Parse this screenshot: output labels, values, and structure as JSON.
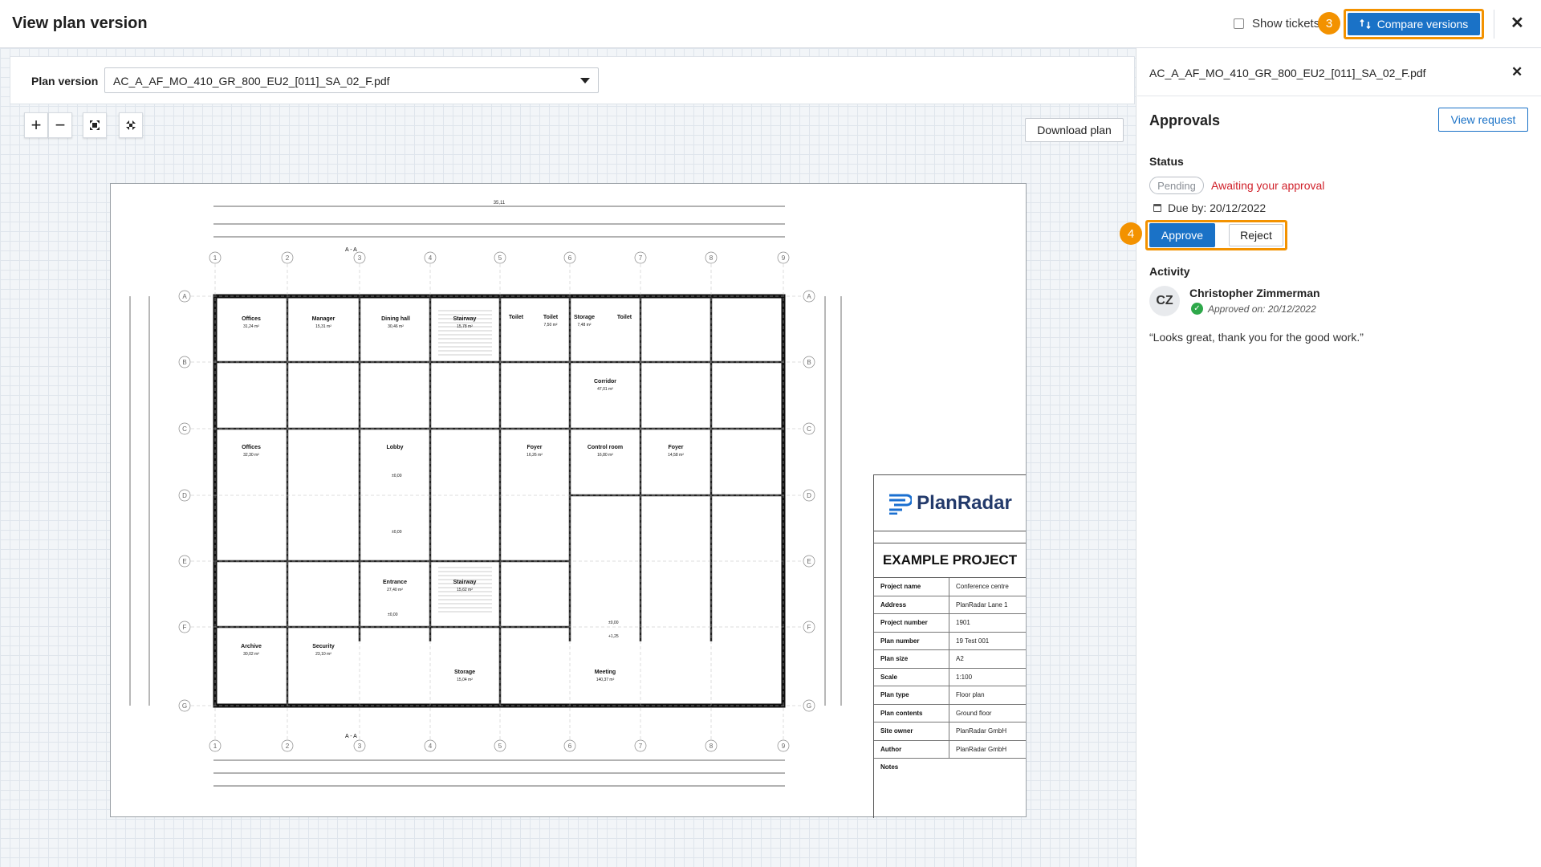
{
  "header": {
    "title": "View plan version",
    "show_tickets_label": "Show tickets",
    "step_3": "3",
    "compare_label": "Compare versions",
    "close_symbol": "✕"
  },
  "toolbar": {
    "plan_version_label": "Plan version",
    "plan_file": "AC_A_AF_MO_410_GR_800_EU2_[011]_SA_02_F.pdf",
    "zoom_in": "+",
    "zoom_out": "−",
    "download_label": "Download plan",
    "icons": [
      "plus-icon",
      "minus-icon",
      "fit-to-screen-icon",
      "collapse-icon",
      "chevron-down-icon"
    ]
  },
  "plan": {
    "logo_text": "PlanRadar",
    "project_title": "EXAMPLE PROJECT",
    "rows": [
      {
        "k": "Project name",
        "v": "Conference centre"
      },
      {
        "k": "Address",
        "v": "PlanRadar Lane 1"
      },
      {
        "k": "Project number",
        "v": "1901"
      },
      {
        "k": "Plan number",
        "v": "19 Test 001"
      },
      {
        "k": "Plan size",
        "v": "A2"
      },
      {
        "k": "Scale",
        "v": "1:100"
      },
      {
        "k": "Plan type",
        "v": "Floor plan"
      },
      {
        "k": "Plan contents",
        "v": "Ground floor"
      },
      {
        "k": "Site owner",
        "v": "PlanRadar GmbH"
      },
      {
        "k": "Author",
        "v": "PlanRadar GmbH"
      }
    ],
    "notes_label": "Notes",
    "rooms": [
      {
        "name": "Offices",
        "area": "31,24 m²"
      },
      {
        "name": "Manager",
        "area": "15,31 m²"
      },
      {
        "name": "Dining hall",
        "area": "30,46 m²"
      },
      {
        "name": "Stairway",
        "area": "15,78 m²"
      },
      {
        "name": "Toilet",
        "area": ""
      },
      {
        "name": "Toilet",
        "area": "7,50 m²"
      },
      {
        "name": "Storage",
        "area": "7,48 m²"
      },
      {
        "name": "Toilet",
        "area": ""
      },
      {
        "name": "Corridor",
        "area": "47,01 m²"
      },
      {
        "name": "Offices",
        "area": "32,30 m²"
      },
      {
        "name": "Lobby",
        "area": ""
      },
      {
        "name": "Foyer",
        "area": "16,26 m²"
      },
      {
        "name": "Control room",
        "area": "16,80 m²"
      },
      {
        "name": "Foyer",
        "area": "14,58 m²"
      },
      {
        "name": "Entrance",
        "area": "27,40 m²"
      },
      {
        "name": "Stairway",
        "area": "15,62 m²"
      },
      {
        "name": "Archive",
        "area": "30,02 m²"
      },
      {
        "name": "Security",
        "area": "23,10 m²"
      },
      {
        "name": "Storage",
        "area": "15,04 m²"
      },
      {
        "name": "Meeting",
        "area": "140,37 m²"
      }
    ],
    "grid_numbers": [
      "1",
      "2",
      "3",
      "4",
      "5",
      "6",
      "7",
      "8",
      "9"
    ],
    "grid_letters": [
      "A",
      "B",
      "C",
      "D",
      "E",
      "F",
      "G"
    ],
    "section_label": "A - A",
    "top_dimension": "35,11",
    "levels": [
      "±0,00",
      "±0,00",
      "±0,00",
      "±0,00",
      "+1,25"
    ]
  },
  "panel": {
    "filename": "AC_A_AF_MO_410_GR_800_EU2_[011]_SA_02_F.pdf",
    "approvals_title": "Approvals",
    "view_request_label": "View request",
    "status_label": "Status",
    "status_value": "Pending",
    "awaiting_text": "Awaiting your approval",
    "due_text": "Due by: 20/12/2022",
    "step_4": "4",
    "approve_label": "Approve",
    "reject_label": "Reject",
    "activity_label": "Activity",
    "avatar_initials": "CZ",
    "user_name": "Christopher Zimmerman",
    "approved_on": "Approved on: 20/12/2022",
    "comment": "“Looks great, thank you for the good work.”"
  },
  "colors": {
    "accent": "#1a72c7",
    "highlight": "#f39200",
    "awaiting": "#d0202a",
    "success": "#2ea84a"
  }
}
